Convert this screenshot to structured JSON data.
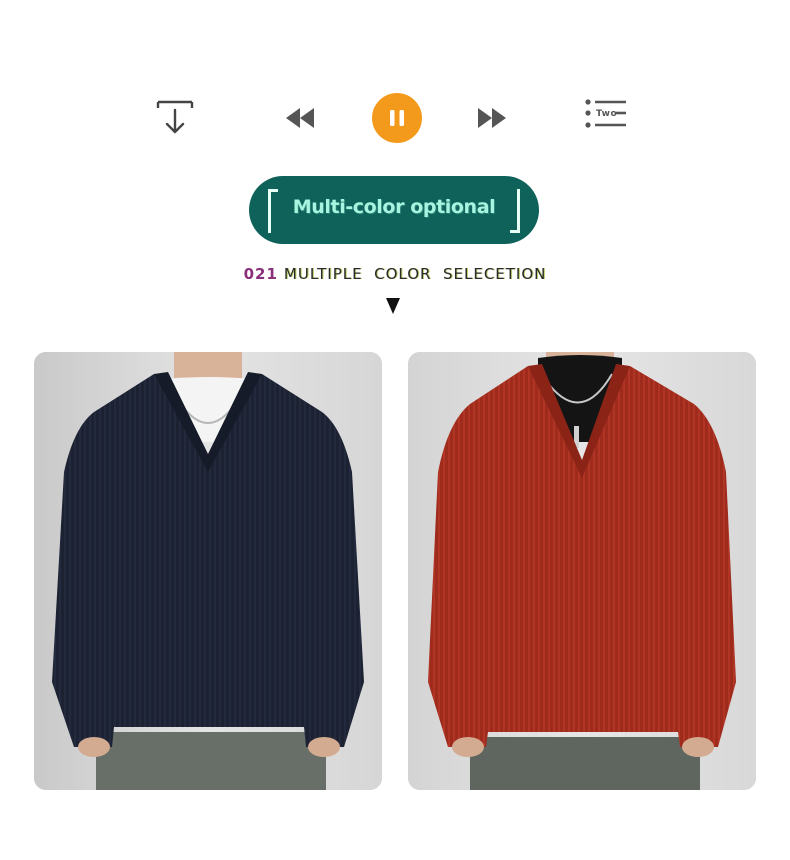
{
  "player": {
    "controls": [
      {
        "name": "download",
        "icon": "download-icon"
      },
      {
        "name": "previous",
        "icon": "rewind-icon"
      },
      {
        "name": "pause",
        "icon": "pause-icon"
      },
      {
        "name": "next",
        "icon": "fast-forward-icon"
      },
      {
        "name": "playlist",
        "icon": "playlist-icon"
      }
    ],
    "playlist_label": "Two",
    "accent_color": "#f39a1c"
  },
  "banner": {
    "title": "Multi-color optional",
    "background_color": "#0e625a"
  },
  "section": {
    "number": "021",
    "heading": "MULTIPLE  COLOR  SELECETION"
  },
  "products": [
    {
      "color_name": "navy",
      "color_hex": "#1c2232",
      "layer": "white t-shirt"
    },
    {
      "color_name": "red",
      "color_hex": "#9e2b1c",
      "layer": "black turtleneck"
    }
  ]
}
